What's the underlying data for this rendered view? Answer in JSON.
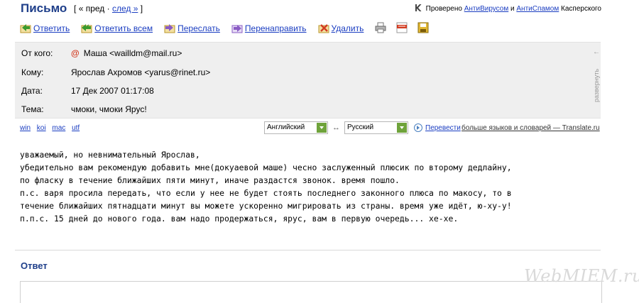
{
  "header": {
    "title": "Письмо",
    "nav_open": "[",
    "nav_prev": "« пред",
    "nav_dot": "·",
    "nav_next": "след »",
    "nav_close": "]"
  },
  "scan": {
    "prefix": "Проверено",
    "antivirus": "АнтиВирусом",
    "and": "и",
    "antispam": "АнтиСпамом",
    "suffix": "Касперского"
  },
  "toolbar": {
    "reply": "Ответить",
    "reply_all": "Ответить всем",
    "forward": "Переслать",
    "redirect": "Перенаправить",
    "delete": "Удалить"
  },
  "message": {
    "from_label": "От кого:",
    "from_value": "Маша <wailldm@mail.ru>",
    "to_label": "Кому:",
    "to_value": "Ярослав Ахромов <yarus@rinet.ru>",
    "date_label": "Дата:",
    "date_value": "17 Дек 2007 01:17:08",
    "subject_label": "Тема:",
    "subject_value": "чмоки, чмоки Ярус!",
    "expand_label": "развернуть",
    "expand_arrow": "←"
  },
  "encodings": [
    "win",
    "koi",
    "mac",
    "utf"
  ],
  "translate": {
    "source_lang": "Английский",
    "target_lang": "Русский",
    "swap": "↔",
    "translate_label": "Перевести",
    "more_link": "больше языков и словарей — Translate.ru"
  },
  "body": {
    "lines": [
      "уважаемый, но невнимательный Ярослав,",
      "убедительно вам рекомендую добавить мне(докуаевой маше) чесно заслуженный плюсик по второму дедлайну,",
      "по фласку в течение ближайших пяти минут, иначе раздастся звонок. время пошло.",
      "п.с. варя просила передать, что если у нее не будет стоять последнего законного плюса по макосу, то в",
      "течение ближайших пятнадцати минут вы можете ускоренно мигрировать из страны. время уже идёт, ю-ху-у!",
      "п.п.с. 15 дней до нового года. вам надо продержаться, ярус, вам в первую очередь... хе-хе."
    ]
  },
  "reply": {
    "title": "Ответ"
  },
  "watermark": "WebMIEM.ru"
}
